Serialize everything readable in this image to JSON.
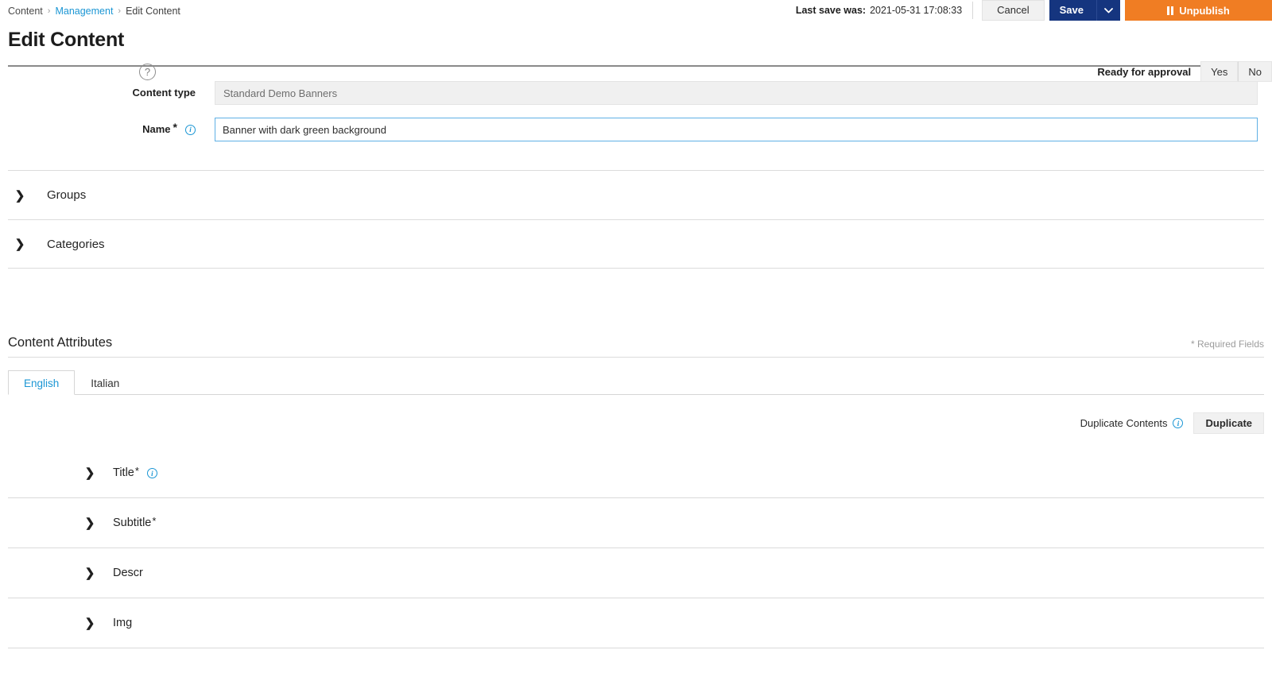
{
  "breadcrumb": {
    "items": [
      {
        "label": "Content",
        "type": "plain"
      },
      {
        "label": "Management",
        "type": "link"
      },
      {
        "label": "Edit Content",
        "type": "plain"
      }
    ],
    "separator": "›"
  },
  "topbar": {
    "last_save_label": "Last save was:",
    "last_save_value": "2021-05-31 17:08:33",
    "cancel_label": "Cancel",
    "save_label": "Save",
    "save_caret": "⌄",
    "unpublish_label": "Unpublish"
  },
  "header": {
    "title": "Edit Content",
    "help_icon": "question-mark-icon",
    "help_glyph": "?",
    "approval_label": "Ready for approval",
    "approval_yes": "Yes",
    "approval_no": "No"
  },
  "form": {
    "content_type": {
      "label": "Content type",
      "value": "Standard Demo Banners",
      "placeholder": "Standard Demo Banners"
    },
    "name": {
      "label": "Name",
      "required_marker": "*",
      "value": "Banner with dark green background",
      "placeholder": "",
      "info_glyph": "i"
    }
  },
  "sections": [
    {
      "label": "Groups",
      "chevron": "❯"
    },
    {
      "label": "Categories",
      "chevron": "❯"
    }
  ],
  "attributes_panel": {
    "title": "Content Attributes",
    "required_note": "* Required Fields",
    "tabs": [
      {
        "label": "English",
        "active": true
      },
      {
        "label": "Italian",
        "active": false
      }
    ],
    "duplicate_label": "Duplicate Contents",
    "duplicate_info_glyph": "i",
    "duplicate_button": "Duplicate",
    "items": [
      {
        "label": "Title",
        "required": "*",
        "has_info": true,
        "chevron": "❯"
      },
      {
        "label": "Subtitle",
        "required": "*",
        "has_info": false,
        "chevron": "❯"
      },
      {
        "label": "Descr",
        "required": "",
        "has_info": false,
        "chevron": "❯"
      },
      {
        "label": "Img",
        "required": "",
        "has_info": false,
        "chevron": "❯"
      }
    ]
  },
  "colors": {
    "link": "#1b96d4",
    "save": "#15357f",
    "unpublish": "#f07d23",
    "focus_border": "#5fb0e5",
    "rule": "#8a8a8a"
  }
}
